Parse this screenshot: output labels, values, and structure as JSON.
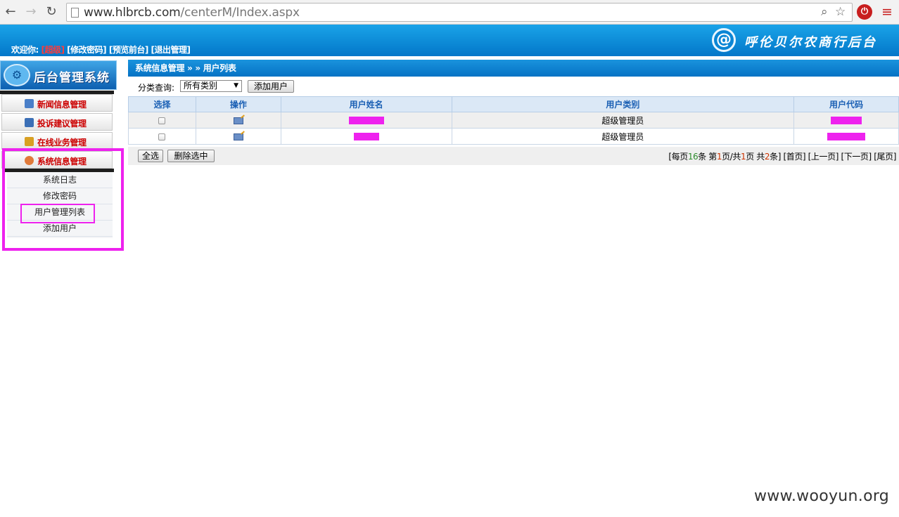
{
  "browser": {
    "url_host": "www.hlbrcb.com",
    "url_path": "/centerM/Index.aspx"
  },
  "header": {
    "welcome_prefix": "欢迎你:",
    "username": "[超级]",
    "links": [
      "[修改密码]",
      "[预览前台]",
      "[退出管理]"
    ],
    "brand_name": "呼伦贝尔农商行后台"
  },
  "sidebar": {
    "title": "后台管理系统",
    "menu": [
      {
        "label": "新闻信息管理",
        "color": "#4a7fc8"
      },
      {
        "label": "投诉建议管理",
        "color": "#3b6fb6"
      },
      {
        "label": "在线业务管理",
        "color": "#d8a023"
      },
      {
        "label": "系统信息管理",
        "color": "#e07a3a"
      }
    ],
    "submenu": [
      "系统日志",
      "修改密码",
      "用户管理列表",
      "添加用户"
    ]
  },
  "main": {
    "breadcrumb": "系统信息管理 » » 用户列表",
    "filter_label": "分类查询:",
    "filter_selected": "所有类别",
    "add_user_label": "添加用户",
    "columns": [
      "选择",
      "操作",
      "用户姓名",
      "用户类别",
      "用户代码"
    ],
    "rows": [
      {
        "category": "超级管理员"
      },
      {
        "category": "超级管理员"
      }
    ],
    "select_all_label": "全选",
    "delete_selected_label": "删除选中",
    "pager": {
      "prefix": "[每页",
      "per_page": "16",
      "mid1": "条 第",
      "current": "1",
      "mid2": "页/共",
      "pages": "1",
      "mid3": "页 共",
      "total": "2",
      "suffix": "条]",
      "first": "[首页]",
      "prev": "[上一页]",
      "next": "[下一页]",
      "last": "[尾页]"
    }
  },
  "watermark": "www.wooyun.org",
  "colors": {
    "accent_blue": "#0a84d6",
    "highlight_magenta": "#ee22ee",
    "menu_red": "#cc0000"
  }
}
